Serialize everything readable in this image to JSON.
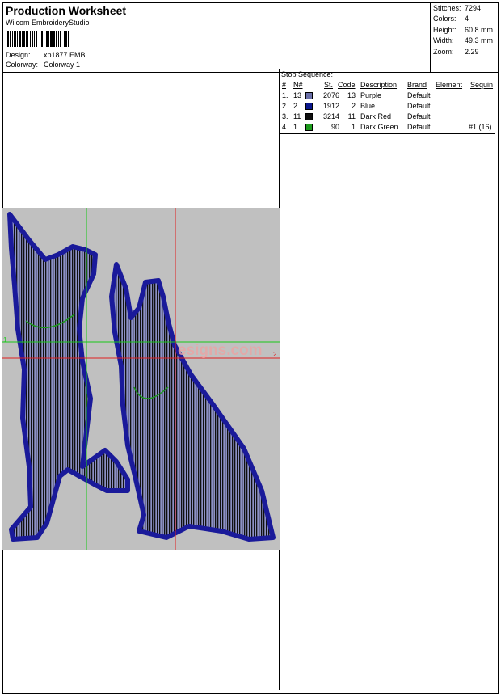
{
  "header": {
    "title": "Production Worksheet",
    "software": "Wilcom EmbroideryStudio",
    "design_label": "Design:",
    "design_value": "xp1877.EMB",
    "colorway_label": "Colorway:",
    "colorway_value": "Colorway 1"
  },
  "stats": [
    {
      "label": "Stitches:",
      "value": "7294"
    },
    {
      "label": "Colors:",
      "value": "4"
    },
    {
      "label": "Height:",
      "value": "60.8 mm"
    },
    {
      "label": "Width:",
      "value": "49.3 mm"
    },
    {
      "label": "Zoom:",
      "value": "2.29"
    }
  ],
  "stop_sequence": {
    "title": "Stop Sequence:",
    "columns": {
      "idx": "#",
      "n": "N#",
      "st": "St.",
      "code": "Code",
      "desc": "Description",
      "brand": "Brand",
      "element": "Element",
      "seq": "Sequin"
    },
    "rows": [
      {
        "idx": "1.",
        "n": "13",
        "color": "#6a6fa8",
        "st": "2076",
        "code": "13",
        "desc": "Purple",
        "brand": "Default",
        "seq": ""
      },
      {
        "idx": "2.",
        "n": "2",
        "color": "#0a168c",
        "st": "1912",
        "code": "2",
        "desc": "Blue",
        "brand": "Default",
        "seq": ""
      },
      {
        "idx": "3.",
        "n": "11",
        "color": "#101010",
        "st": "3214",
        "code": "11",
        "desc": "Dark Red",
        "brand": "Default",
        "seq": ""
      },
      {
        "idx": "4.",
        "n": "1",
        "color": "#1c9a1c",
        "st": "90",
        "code": "1",
        "desc": "Dark Green",
        "brand": "Default",
        "seq": "#1 (16)"
      }
    ]
  },
  "design_view": {
    "background": "#c0c0c0",
    "watermark": "esigns.com",
    "axis_marker_left": "1",
    "axis_marker_right": "2"
  }
}
